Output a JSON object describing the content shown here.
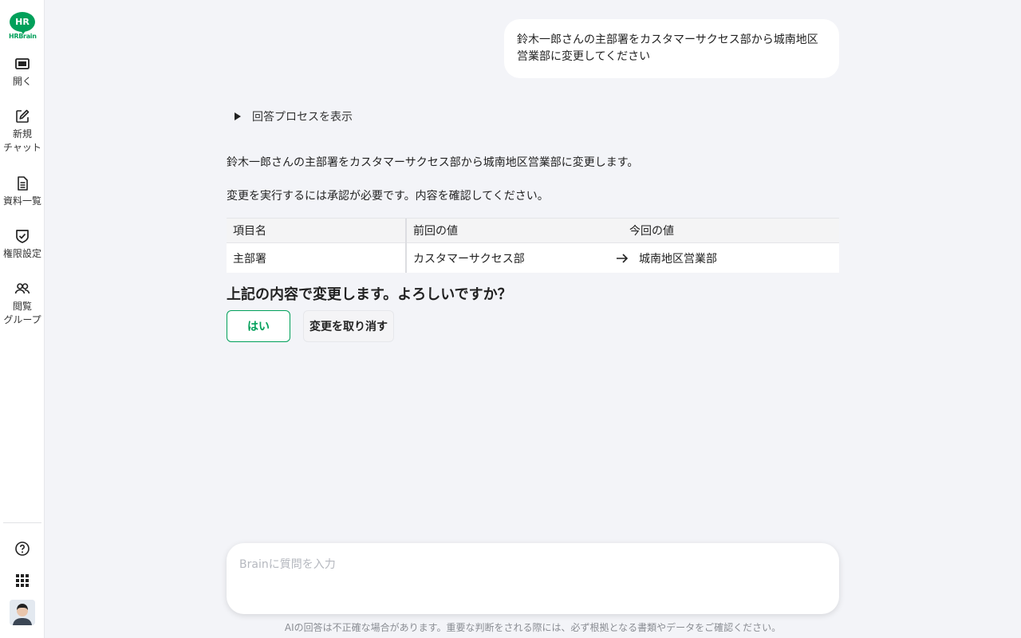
{
  "app": {
    "logo_text": "HRBrain",
    "logo_badge": "HR",
    "brand_color": "#00a05a"
  },
  "sidebar": {
    "items": [
      {
        "label": "開く",
        "icon": "panel-icon"
      },
      {
        "label": "新規\nチャット",
        "icon": "edit-icon"
      },
      {
        "label": "資料一覧",
        "icon": "document-icon"
      },
      {
        "label": "権限設定",
        "icon": "shield-check-icon"
      },
      {
        "label": "閲覧\nグループ",
        "icon": "users-icon"
      }
    ],
    "bottom": [
      "help-icon",
      "apps-grid-icon",
      "avatar"
    ]
  },
  "chat": {
    "user_message": "鈴木一郎さんの主部署をカスタマーサクセス部から城南地区営業部に変更してください",
    "process_toggle_label": "回答プロセスを表示",
    "answer_line1": "鈴木一郎さんの主部署をカスタマーサクセス部から城南地区営業部に変更します。",
    "answer_line2": "変更を実行するには承認が必要です。内容を確認してください。",
    "table": {
      "headers": {
        "item": "項目名",
        "previous": "前回の値",
        "current": "今回の値"
      },
      "rows": [
        {
          "item": "主部署",
          "previous": "カスタマーサクセス部",
          "current": "城南地区営業部"
        }
      ]
    },
    "confirm_question": "上記の内容で変更します。よろしいですか？",
    "yes_label": "はい",
    "cancel_label": "変更を取り消す"
  },
  "input": {
    "placeholder": "Brainに質問を入力",
    "value": ""
  },
  "disclaimer": "AIの回答は不正確な場合があります。重要な判断をされる際には、必ず根拠となる書類やデータをご確認ください。"
}
